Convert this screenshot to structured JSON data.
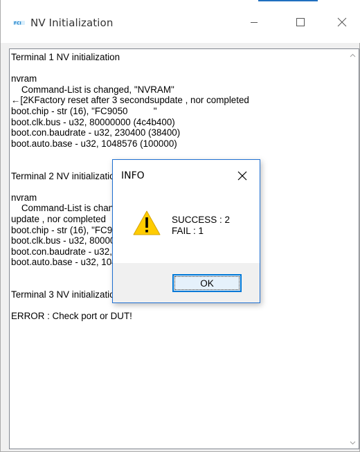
{
  "window": {
    "title": "NV Initialization",
    "app_icon": "app-logo-icon",
    "accent_color": "#1f6fbf",
    "controls": {
      "minimize": "minimize-icon",
      "maximize": "maximize-icon",
      "close": "close-icon"
    }
  },
  "output": {
    "text": "Terminal 1 NV initialization\n\nnvram\n    Command-List is changed, \"NVRAM\"\n←[2KFactory reset after 3 secondsupdate , nor completed\nboot.chip - str (16), \"FC9050          \"\nboot.clk.bus - u32, 80000000 (4c4b400)\nboot.con.baudrate - u32, 230400 (38400)\nboot.auto.base - u32, 1048576 (100000)\n\n\nTerminal 2 NV initialization\n\nnvram\n    Command-List is changed, \"NVRAM\"\nupdate , nor completed\nboot.chip - str (16), \"FC9050          \"\nboot.clk.bus - u32, 80000000 (4c4b400)\nboot.con.baudrate - u32, 230400 (38400)\nboot.auto.base - u32, 1048576 (100000)\n\n\nTerminal 3 NV initialization\n\nERROR : Check port or DUT!",
    "scrollbar": {
      "up_icon": "scroll-up-arrow-icon",
      "down_icon": "scroll-down-arrow-icon"
    }
  },
  "dialog": {
    "title": "INFO",
    "close_icon": "close-icon",
    "icon": "warning-icon",
    "message": "SUCCESS : 2\nFAIL : 1",
    "ok_label": "OK",
    "border_color": "#1e6fd1",
    "button_accent": "#0078d7"
  }
}
